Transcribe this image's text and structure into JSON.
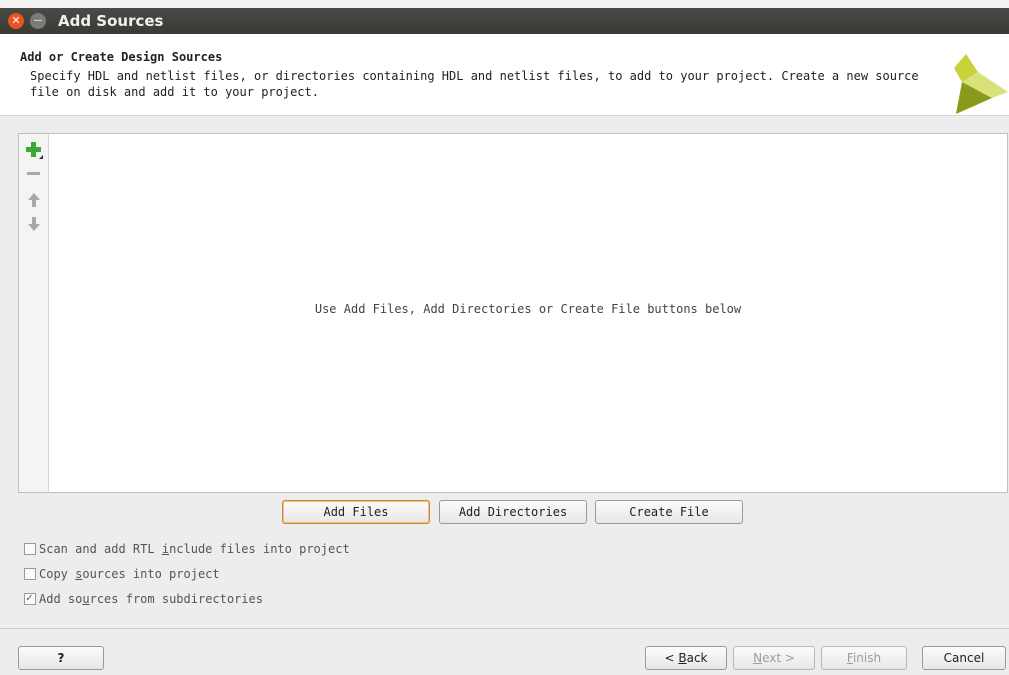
{
  "window": {
    "title": "Add Sources"
  },
  "header": {
    "title": "Add or Create Design Sources",
    "description": "Specify HDL and netlist files, or directories containing HDL and netlist files, to add to your project. Create a new source file on disk and add it to your project."
  },
  "toolbar": {
    "add_icon": "plus-icon",
    "remove_icon": "minus-icon",
    "up_icon": "arrow-up-icon",
    "down_icon": "arrow-down-icon"
  },
  "list": {
    "empty_message": "Use Add Files, Add Directories or Create File buttons below"
  },
  "actions": {
    "add_files": "Add Files",
    "add_directories": "Add Directories",
    "create_file": "Create File"
  },
  "options": [
    {
      "label_pre": "Scan and add RTL ",
      "label_key": "i",
      "label_post": "nclude files into project",
      "checked": false
    },
    {
      "label_pre": "Copy ",
      "label_key": "s",
      "label_post": "ources into project",
      "checked": false
    },
    {
      "label_pre": "Add so",
      "label_key": "u",
      "label_post": "rces from subdirectories",
      "checked": true
    }
  ],
  "footer": {
    "help": "?",
    "back_pre": "< ",
    "back_key": "B",
    "back_post": "ack",
    "next_key": "N",
    "next_post": "ext >",
    "finish_key": "F",
    "finish_post": "inish",
    "cancel": "Cancel"
  },
  "colors": {
    "titlebar": "#3c3b37",
    "close": "#e95420",
    "add_icon": "#3aa935",
    "logo_dark": "#8a9a1b",
    "logo_light": "#c8d23a"
  }
}
